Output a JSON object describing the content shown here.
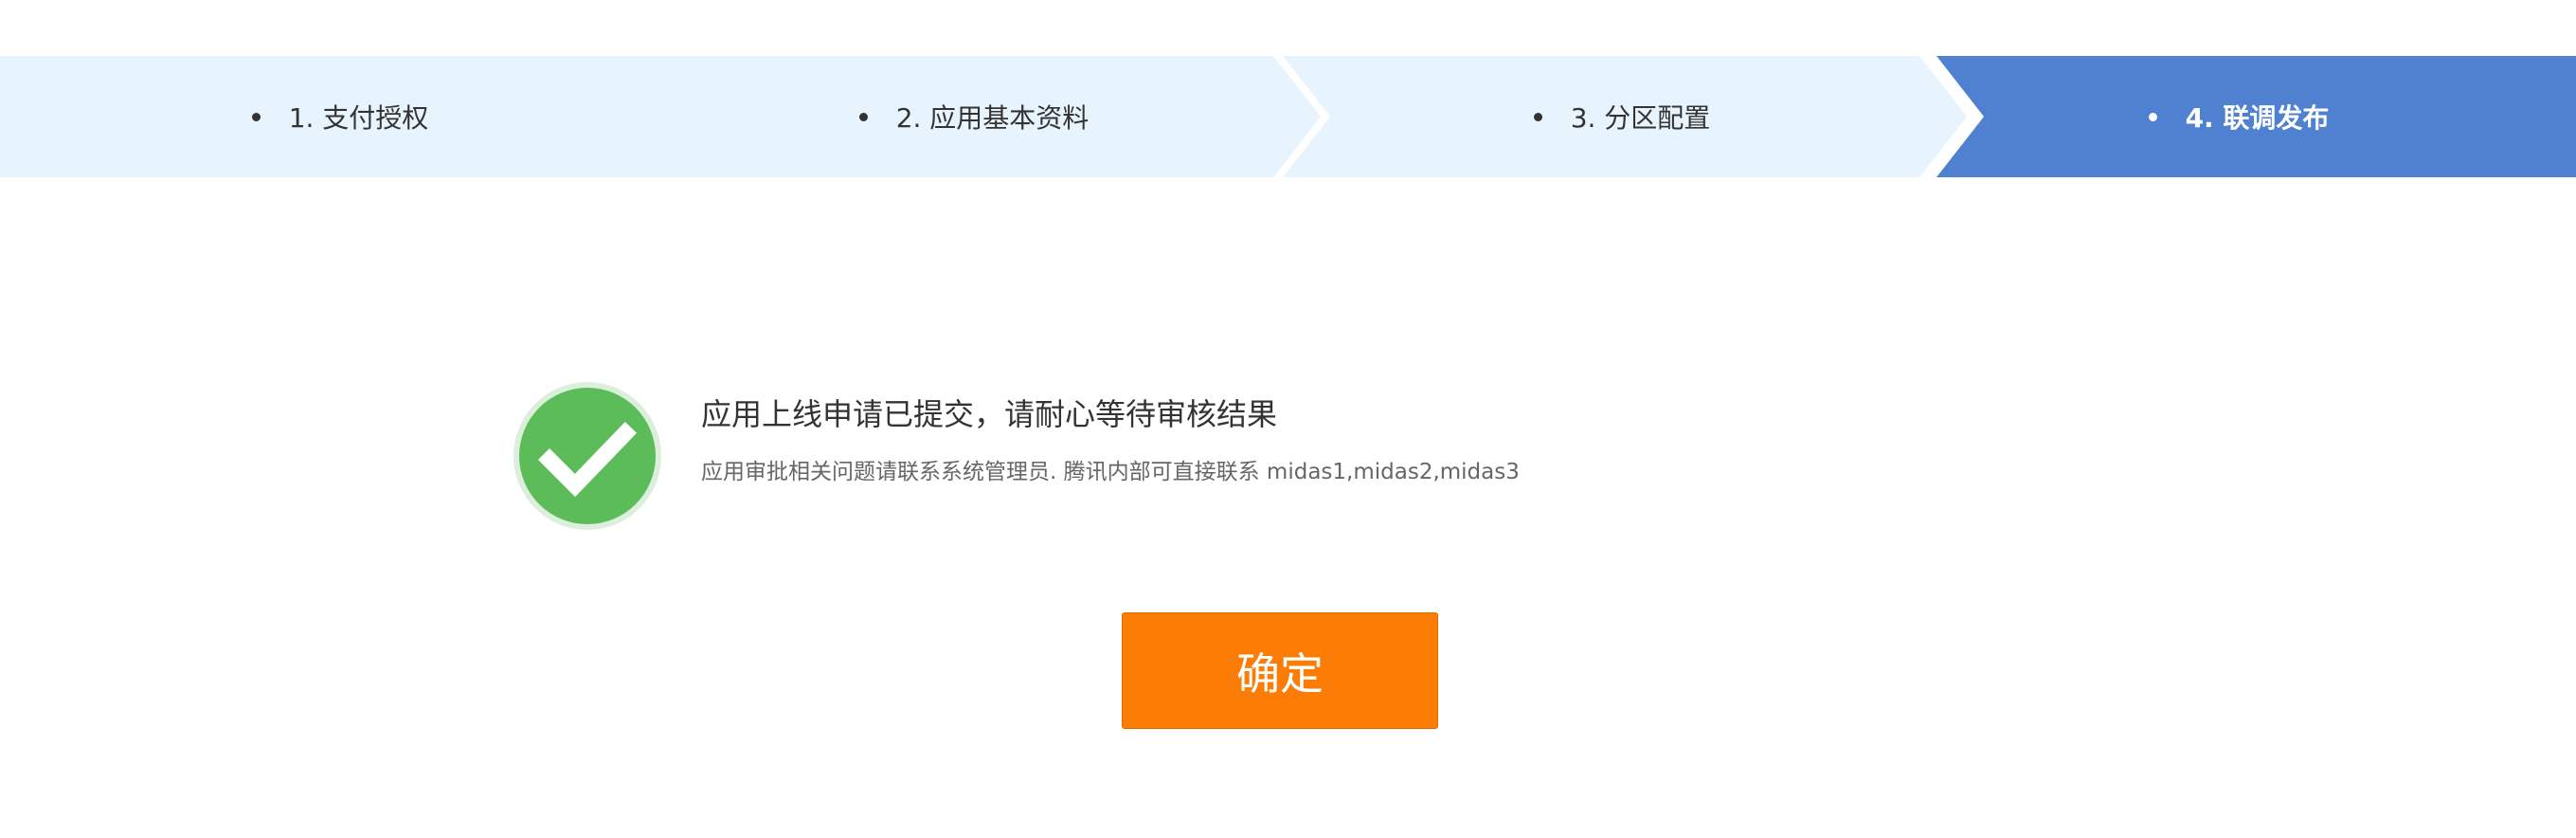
{
  "steps": [
    {
      "label": "1. 支付授权",
      "active": false
    },
    {
      "label": "2. 应用基本资料",
      "active": false
    },
    {
      "label": "3. 分区配置",
      "active": false
    },
    {
      "label": "4. 联调发布",
      "active": true
    }
  ],
  "result": {
    "title": "应用上线申请已提交，请耐心等待审核结果",
    "subtitle": "应用审批相关问题请联系系统管理员. 腾讯内部可直接联系 midas1,midas2,midas3",
    "icon": "check-circle-icon"
  },
  "confirm_label": "确定",
  "colors": {
    "step_inactive": "#e8f4fd",
    "step_active": "#4f81d0",
    "success": "#5cbc5a",
    "button": "#fb7d06"
  }
}
